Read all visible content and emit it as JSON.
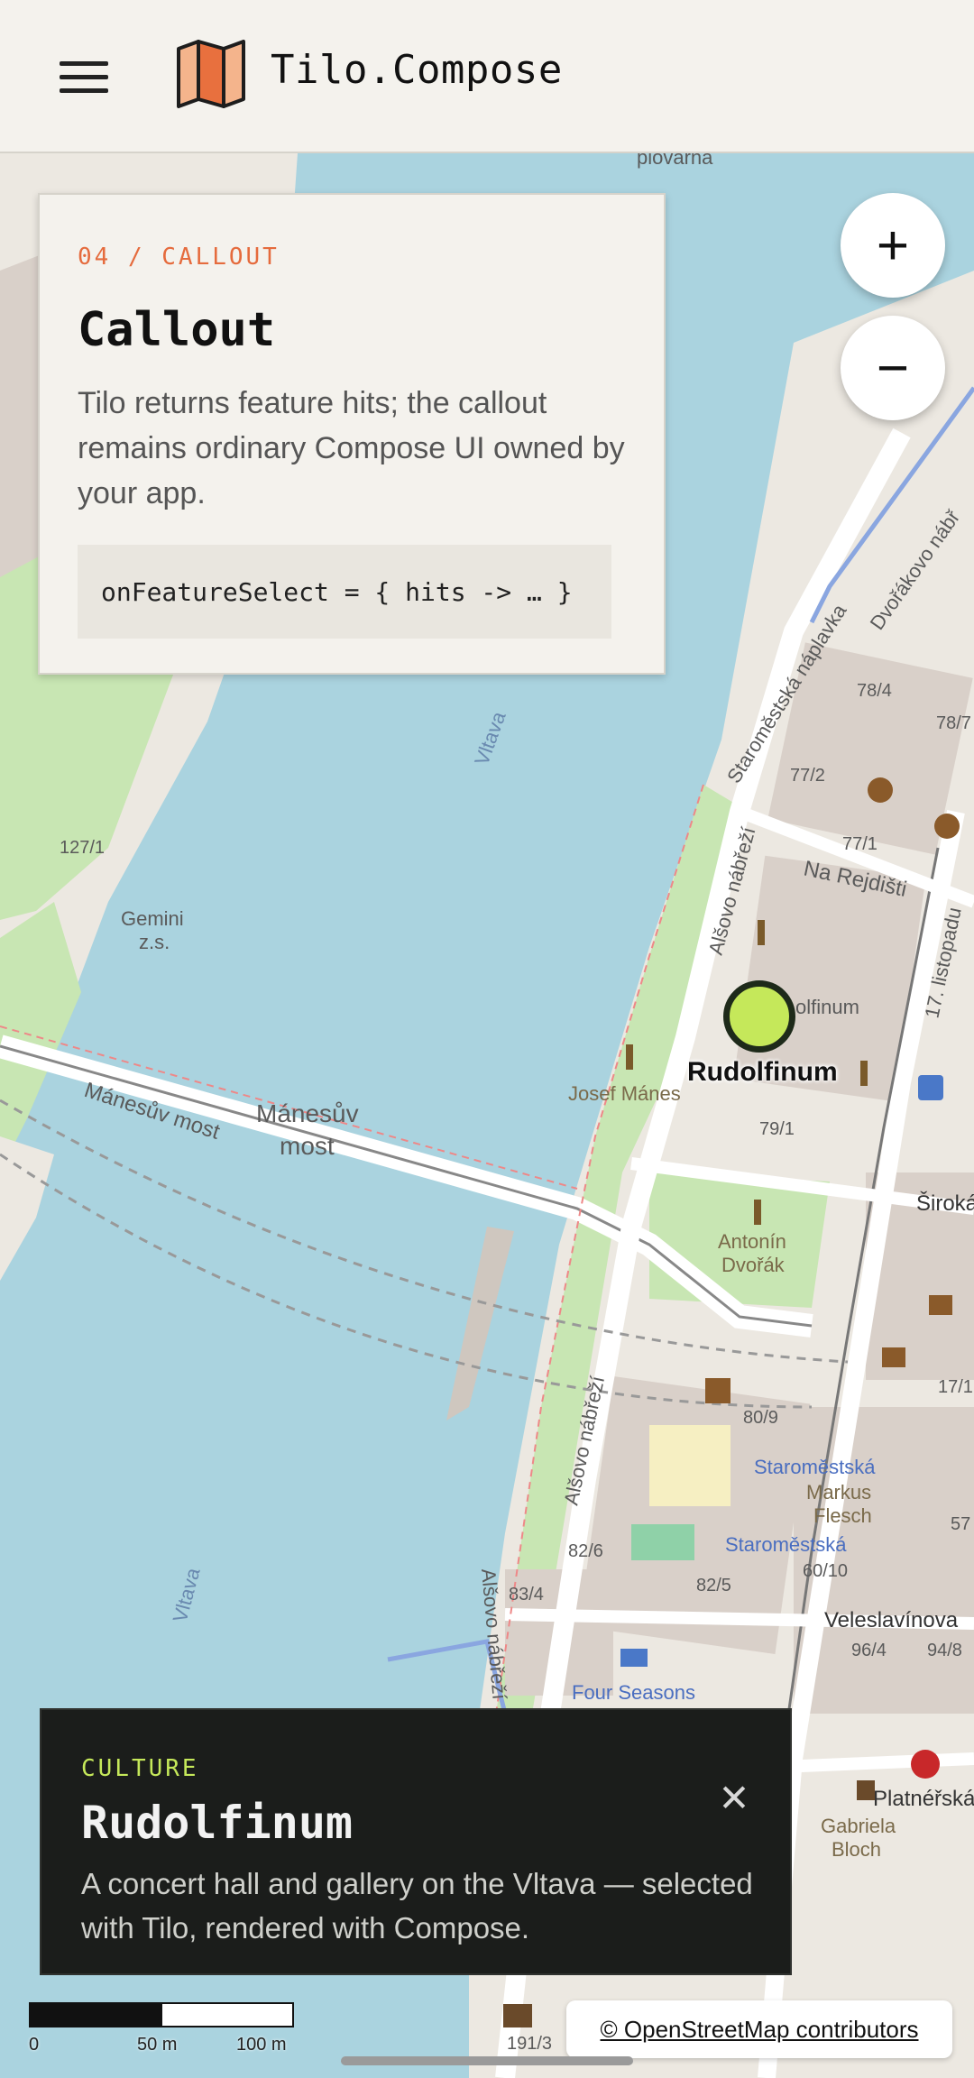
{
  "app": {
    "title": "Tilo.Compose"
  },
  "info_card": {
    "eyebrow": "04 / CALLOUT",
    "title": "Callout",
    "body": "Tilo returns feature hits; the callout remains ordinary Compose UI owned by your app.",
    "code": "onFeatureSelect = { hits -> … }"
  },
  "zoom": {
    "in_symbol": "+",
    "out_symbol": "−"
  },
  "marker": {
    "label": "Rudolfinum",
    "color": "#c5e85a"
  },
  "map_labels": {
    "manesuv_most_road": "Mánesův most",
    "manesuv_most_line1": "Mánesův",
    "manesuv_most_line2": "most",
    "gemini_1": "Gemini",
    "gemini_2": "z.s.",
    "josef_manes": "Josef Mánes",
    "antonin_1": "Antonín",
    "antonin_2": "Dvořák",
    "alsovo_1": "Alšovo nábřeží",
    "alsovo_2": "Alšovo nábřeží",
    "alsovo_3": "Alšovo nábřeží",
    "staromestska_naplavka": "Staroměstská náplavka",
    "dvorakovo": "Dvořákovo nábř",
    "na_rejdisti": "Na Rejdišti",
    "listopadu": "17. listopadu",
    "vltava_1": "Vltava",
    "vltava_2": "Vltava",
    "staromestska_1": "Staroměstská",
    "staromestska_2": "Staroměstská",
    "markus_1": "Markus",
    "markus_2": "Flesch",
    "four_seasons": "Four Seasons",
    "veleslavinova": "Veleslavínova",
    "platnerska": "Platnéřská",
    "gabriela_1": "Gabriela",
    "gabriela_2": "Bloch",
    "siroka": "Široká",
    "rudolfinum_bldg": "olfinum",
    "plovarna": "plovárna",
    "nums": [
      "78/4",
      "78/7",
      "77/2",
      "77/1",
      "127/1",
      "79/1",
      "80/9",
      "82/6",
      "82/5",
      "83/4",
      "60/10",
      "96/4",
      "94/8",
      "17/1",
      "57",
      "191/3"
    ]
  },
  "sheet": {
    "category": "CULTURE",
    "title": "Rudolfinum",
    "description": "A concert hall and gallery on the Vltava — selected with Tilo, rendered with Compose.",
    "close_symbol": "✕"
  },
  "scale": {
    "labels": [
      "0",
      "50 m",
      "100 m"
    ]
  },
  "attribution": "© OpenStreetMap contributors",
  "colors": {
    "accent": "#e56b3d",
    "selection": "#c5e85a",
    "water": "#aad3df",
    "park": "#c8e6b3",
    "building": "#d9d0c9",
    "panel": "#f4f2ed",
    "sheet": "#1b1d1b"
  }
}
